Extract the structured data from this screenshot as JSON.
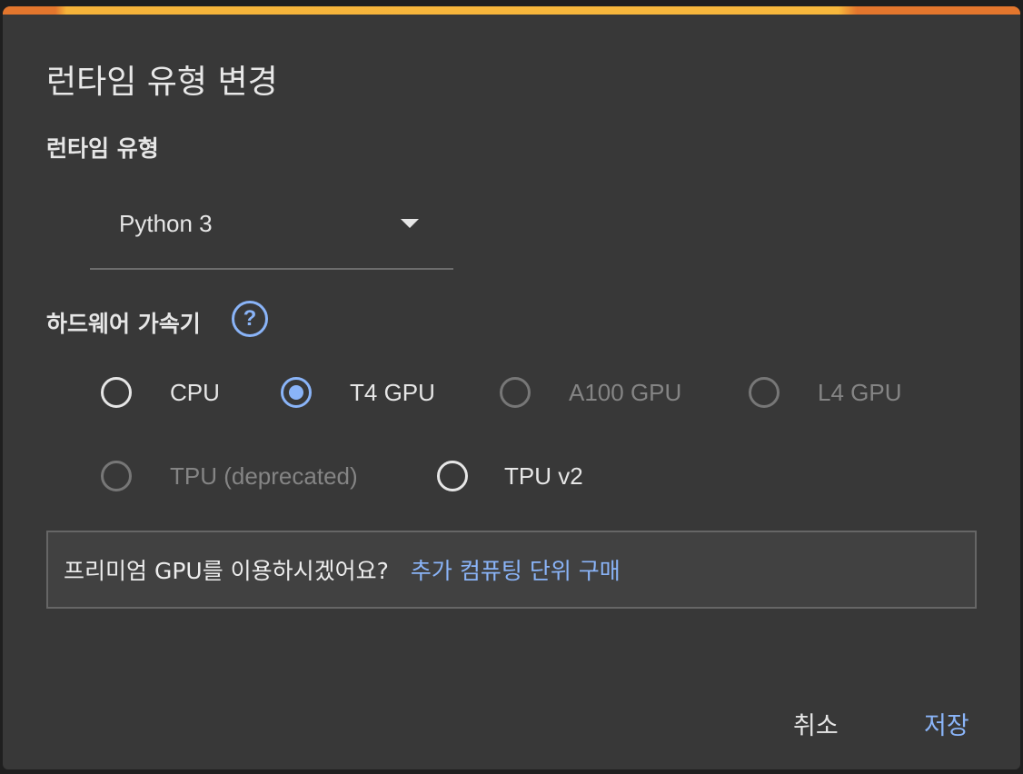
{
  "dialog": {
    "title": "런타임 유형 변경",
    "runtime_label": "런타임 유형",
    "runtime_value": "Python 3",
    "hardware_label": "하드웨어 가속기",
    "help_glyph": "?",
    "accelerators": [
      {
        "label": "CPU",
        "checked": false,
        "disabled": false
      },
      {
        "label": "T4 GPU",
        "checked": true,
        "disabled": false
      },
      {
        "label": "A100 GPU",
        "checked": false,
        "disabled": true
      },
      {
        "label": "L4 GPU",
        "checked": false,
        "disabled": true
      },
      {
        "label": "TPU (deprecated)",
        "checked": false,
        "disabled": true
      },
      {
        "label": "TPU v2",
        "checked": false,
        "disabled": false
      }
    ],
    "promo_text": "프리미엄 GPU를 이용하시겠어요?",
    "promo_link": "추가 컴퓨팅 단위 구매",
    "cancel_label": "취소",
    "save_label": "저장"
  },
  "colors": {
    "accent": "#8ab4f8",
    "dialog_bg": "#383838",
    "top_bar": "#f6b73c"
  },
  "icons": {
    "dropdown": "caret-down-icon",
    "help": "help-circle-icon"
  }
}
